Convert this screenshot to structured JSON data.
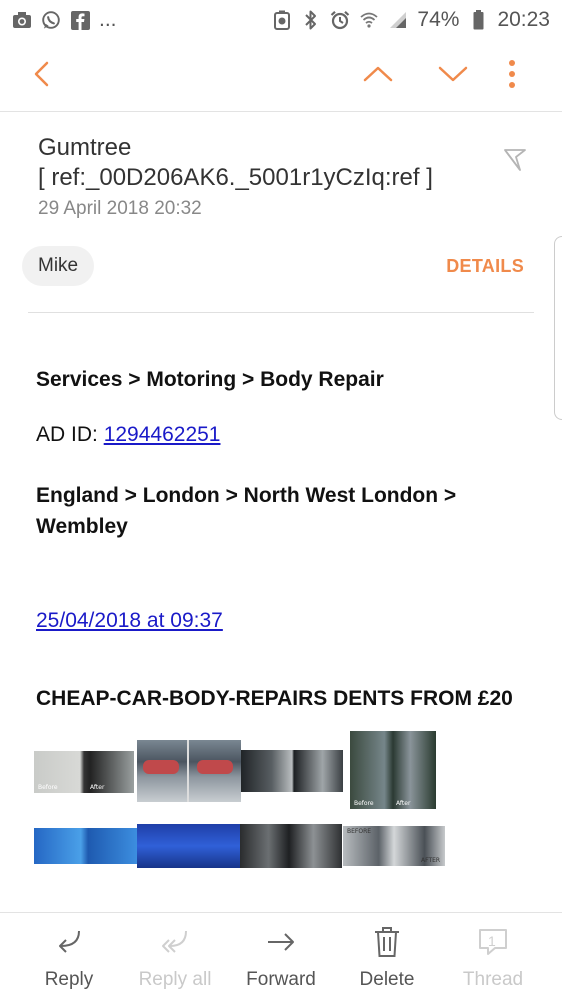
{
  "status_bar": {
    "left_icons": [
      "camera-icon",
      "whatsapp-icon",
      "facebook-icon"
    ],
    "more": "...",
    "battery": "74%",
    "time": "20:23"
  },
  "email": {
    "sender_name": "Gumtree",
    "subject_ref": "[ ref:_00D206AK6._5001r1yCzIq:ref ]",
    "date": "29 April 2018  20:32",
    "recipient": "Mike",
    "details_label": "DETAILS"
  },
  "body": {
    "category_path": "Services > Motoring > Body Repair",
    "ad_id_label": "AD ID: ",
    "ad_id": "1294462251",
    "location_line1": "England > London > North West London >",
    "location_line2": "Wembley",
    "posted_datetime": "25/04/2018 at 09:37",
    "ad_title": "CHEAP-CAR-BODY-REPAIRS DENTS FROM £20"
  },
  "photo_labels": {
    "before": "Before",
    "after": "After",
    "before_caps": "BEFORE",
    "after_caps": "AFTER"
  },
  "bottom_bar": {
    "reply": "Reply",
    "reply_all": "Reply all",
    "forward": "Forward",
    "delete": "Delete",
    "thread": "Thread",
    "thread_count": "1"
  },
  "colors": {
    "accent": "#f08a4b",
    "link": "#1a1ac8"
  }
}
